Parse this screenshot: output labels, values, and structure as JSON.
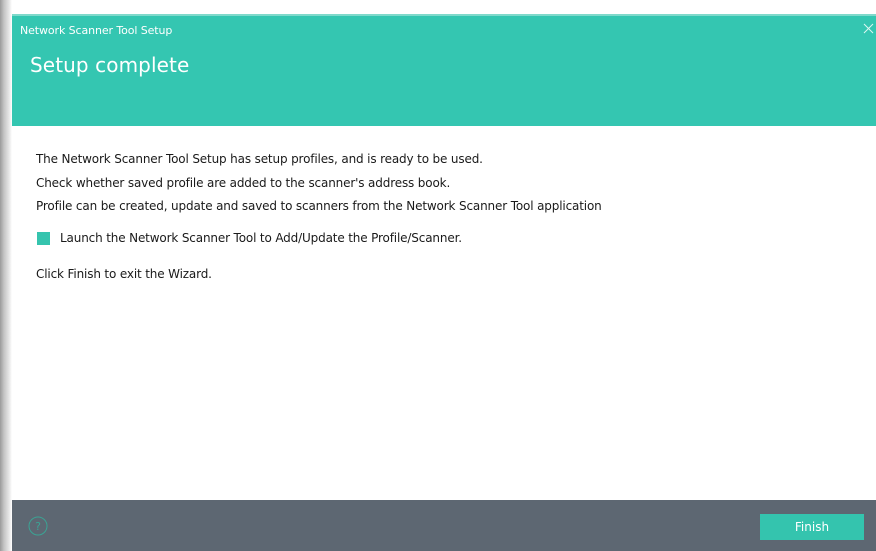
{
  "window": {
    "title": "Network Scanner Tool Setup",
    "close_icon": "close-icon"
  },
  "header": {
    "title": "Setup complete",
    "color": "#34c6b1"
  },
  "content": {
    "lines": [
      "The Network Scanner Tool Setup has setup profiles, and is ready to be used.",
      "Check whether saved profile are added to the scanner's address book.",
      "Profile can be created, update and saved to scanners from the Network Scanner Tool application"
    ],
    "launch_option": {
      "label": "Launch the Network Scanner Tool to Add/Update the Profile/Scanner.",
      "checked": true
    },
    "finish_hint": "Click Finish to exit the Wizard."
  },
  "footer": {
    "help_icon": "help-icon",
    "finish_label": "Finish",
    "color": "#5d6772",
    "button_color": "#34c4ae"
  }
}
